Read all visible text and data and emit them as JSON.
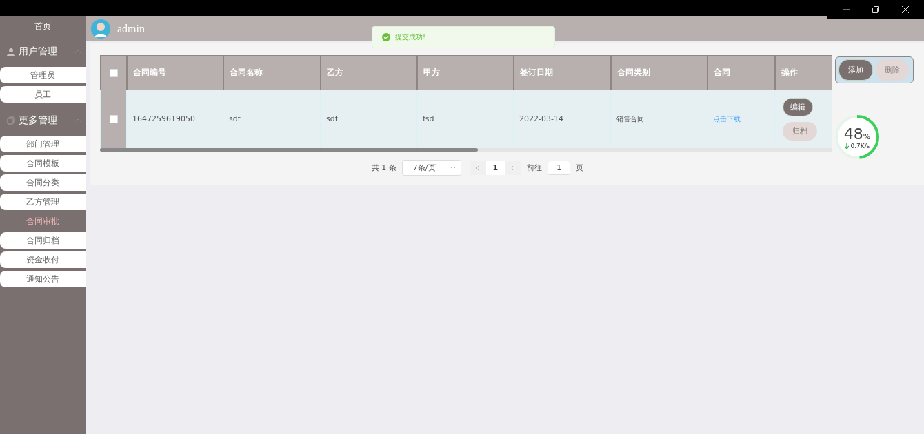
{
  "sidebar": {
    "items": [
      {
        "kind": "link",
        "label": "首页"
      },
      {
        "kind": "group",
        "label": "用户管理",
        "expanded": true,
        "children": [
          {
            "label": "管理员",
            "selected": false
          },
          {
            "label": "员工",
            "selected": false
          }
        ]
      },
      {
        "kind": "group",
        "label": "更多管理",
        "expanded": true,
        "children": [
          {
            "label": "部门管理",
            "selected": false
          },
          {
            "label": "合同模板",
            "selected": false
          },
          {
            "label": "合同分类",
            "selected": false
          },
          {
            "label": "乙方管理",
            "selected": false
          },
          {
            "label": "合同审批",
            "selected": true
          },
          {
            "label": "合同归档",
            "selected": false
          },
          {
            "label": "资金收付",
            "selected": false
          },
          {
            "label": "通知公告",
            "selected": false
          }
        ]
      }
    ]
  },
  "header": {
    "username": "admin"
  },
  "toast": {
    "kind": "success",
    "message": "提交成功!"
  },
  "table": {
    "select_all_checked": false,
    "columns": [
      "合同编号",
      "合同名称",
      "乙方",
      "甲方",
      "签订日期",
      "合同类别",
      "合同",
      "操作"
    ],
    "rows": [
      {
        "checked": false,
        "cells": [
          {
            "kind": "text",
            "text": "1647259619050"
          },
          {
            "kind": "text",
            "text": "sdf"
          },
          {
            "kind": "text",
            "text": "sdf"
          },
          {
            "kind": "text",
            "text": "fsd"
          },
          {
            "kind": "text",
            "text": "2022-03-14"
          },
          {
            "kind": "small",
            "text": "销售合同"
          },
          {
            "kind": "link",
            "text": "点击下载"
          }
        ],
        "actions": [
          {
            "label": "编辑",
            "kind": "primary"
          },
          {
            "label": "归档",
            "kind": "muted"
          }
        ]
      }
    ]
  },
  "toolbar": [
    {
      "label": "添加",
      "kind": "primary"
    },
    {
      "label": "删除",
      "kind": "muted"
    }
  ],
  "pagination": {
    "total": "共 1 条",
    "page_size": "7条/页",
    "pages": [
      {
        "label": "1",
        "selected": true
      }
    ],
    "goto_label": "前往",
    "goto_value": "1",
    "goto_suffix": "页"
  },
  "speed_meter": {
    "percent": "48",
    "unit": "%",
    "level": 0.48,
    "speed": "0.7K/s"
  }
}
